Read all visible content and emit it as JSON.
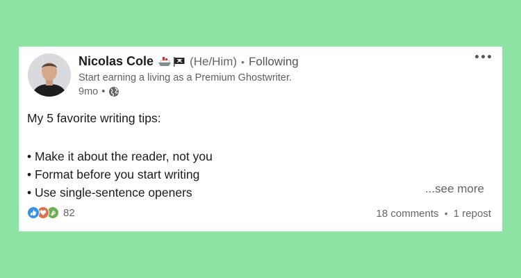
{
  "post": {
    "author": {
      "name": "Nicolas Cole",
      "pronouns": "(He/Him)",
      "connection": "Following",
      "headline": "Start earning a living as a Premium Ghostwriter.",
      "badges": [
        "ship-emoji-icon",
        "pirate-flag-emoji-icon"
      ]
    },
    "meta": {
      "age": "9mo",
      "visibility_icon": "globe-icon"
    },
    "body": {
      "intro": "My 5 favorite writing tips:",
      "tips": [
        "• Make it about the reader, not you",
        "• Format before you start writing",
        "• Use single-sentence openers"
      ],
      "see_more": "...see more"
    },
    "engagement": {
      "reaction_icons": [
        "like-icon",
        "love-icon",
        "celebrate-icon"
      ],
      "reaction_count": "82",
      "comments": "18 comments",
      "reposts": "1 repost"
    },
    "menu_icon": "more-horizontal-icon"
  },
  "colors": {
    "page_background": "#8ce3a4",
    "card_background": "#ffffff",
    "like": "#378fe9",
    "love": "#df704d",
    "celebrate": "#6dae4f"
  }
}
